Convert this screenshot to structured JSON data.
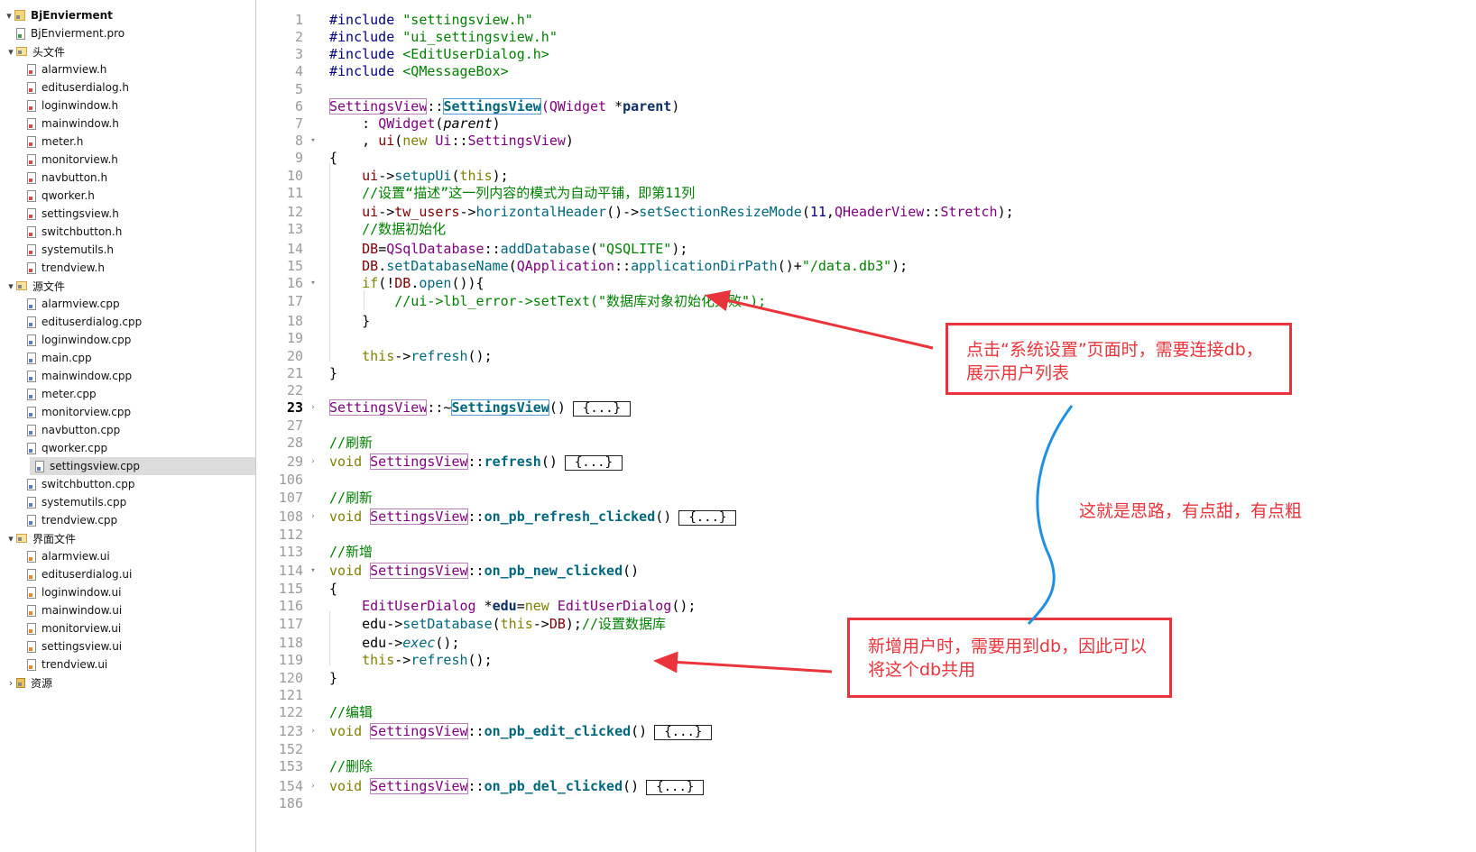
{
  "tree": {
    "items": [
      {
        "label": "BjEnvierment",
        "arrow": "▾",
        "indent": 0,
        "icon": "project-icon",
        "bold": true
      },
      {
        "label": "BjEnvierment.pro",
        "arrow": "",
        "indent": 1,
        "icon": "pro-file-icon"
      },
      {
        "label": "头文件",
        "arrow": "▾",
        "indent": 1,
        "icon": "headers-folder-icon"
      },
      {
        "label": "alarmview.h",
        "arrow": "",
        "indent": 2,
        "icon": "header-file-icon"
      },
      {
        "label": "edituserdialog.h",
        "arrow": "",
        "indent": 2,
        "icon": "header-file-icon"
      },
      {
        "label": "loginwindow.h",
        "arrow": "",
        "indent": 2,
        "icon": "header-file-icon"
      },
      {
        "label": "mainwindow.h",
        "arrow": "",
        "indent": 2,
        "icon": "header-file-icon"
      },
      {
        "label": "meter.h",
        "arrow": "",
        "indent": 2,
        "icon": "header-file-icon"
      },
      {
        "label": "monitorview.h",
        "arrow": "",
        "indent": 2,
        "icon": "header-file-icon"
      },
      {
        "label": "navbutton.h",
        "arrow": "",
        "indent": 2,
        "icon": "header-file-icon"
      },
      {
        "label": "qworker.h",
        "arrow": "",
        "indent": 2,
        "icon": "header-file-icon"
      },
      {
        "label": "settingsview.h",
        "arrow": "",
        "indent": 2,
        "icon": "header-file-icon"
      },
      {
        "label": "switchbutton.h",
        "arrow": "",
        "indent": 2,
        "icon": "header-file-icon"
      },
      {
        "label": "systemutils.h",
        "arrow": "",
        "indent": 2,
        "icon": "header-file-icon"
      },
      {
        "label": "trendview.h",
        "arrow": "",
        "indent": 2,
        "icon": "header-file-icon"
      },
      {
        "label": "源文件",
        "arrow": "▾",
        "indent": 1,
        "icon": "sources-folder-icon"
      },
      {
        "label": "alarmview.cpp",
        "arrow": "",
        "indent": 2,
        "icon": "cpp-file-icon"
      },
      {
        "label": "edituserdialog.cpp",
        "arrow": "",
        "indent": 2,
        "icon": "cpp-file-icon"
      },
      {
        "label": "loginwindow.cpp",
        "arrow": "",
        "indent": 2,
        "icon": "cpp-file-icon"
      },
      {
        "label": "main.cpp",
        "arrow": "",
        "indent": 2,
        "icon": "cpp-file-icon"
      },
      {
        "label": "mainwindow.cpp",
        "arrow": "",
        "indent": 2,
        "icon": "cpp-file-icon"
      },
      {
        "label": "meter.cpp",
        "arrow": "",
        "indent": 2,
        "icon": "cpp-file-icon"
      },
      {
        "label": "monitorview.cpp",
        "arrow": "",
        "indent": 2,
        "icon": "cpp-file-icon"
      },
      {
        "label": "navbutton.cpp",
        "arrow": "",
        "indent": 2,
        "icon": "cpp-file-icon"
      },
      {
        "label": "qworker.cpp",
        "arrow": "",
        "indent": 2,
        "icon": "cpp-file-icon"
      },
      {
        "label": "settingsview.cpp",
        "arrow": "",
        "indent": 2,
        "icon": "cpp-file-icon",
        "selected": true
      },
      {
        "label": "switchbutton.cpp",
        "arrow": "",
        "indent": 2,
        "icon": "cpp-file-icon"
      },
      {
        "label": "systemutils.cpp",
        "arrow": "",
        "indent": 2,
        "icon": "cpp-file-icon"
      },
      {
        "label": "trendview.cpp",
        "arrow": "",
        "indent": 2,
        "icon": "cpp-file-icon"
      },
      {
        "label": "界面文件",
        "arrow": "▾",
        "indent": 1,
        "icon": "forms-folder-icon"
      },
      {
        "label": "alarmview.ui",
        "arrow": "",
        "indent": 2,
        "icon": "ui-file-icon"
      },
      {
        "label": "edituserdialog.ui",
        "arrow": "",
        "indent": 2,
        "icon": "ui-file-icon"
      },
      {
        "label": "loginwindow.ui",
        "arrow": "",
        "indent": 2,
        "icon": "ui-file-icon"
      },
      {
        "label": "mainwindow.ui",
        "arrow": "",
        "indent": 2,
        "icon": "ui-file-icon"
      },
      {
        "label": "monitorview.ui",
        "arrow": "",
        "indent": 2,
        "icon": "ui-file-icon"
      },
      {
        "label": "settingsview.ui",
        "arrow": "",
        "indent": 2,
        "icon": "ui-file-icon"
      },
      {
        "label": "trendview.ui",
        "arrow": "",
        "indent": 2,
        "icon": "ui-file-icon"
      },
      {
        "label": "资源",
        "arrow": "›",
        "indent": 1,
        "icon": "resources-lock-icon"
      }
    ]
  },
  "editor": {
    "current_line": "23",
    "lines": [
      {
        "n": "1",
        "tokens": [
          [
            "pp",
            "#include "
          ],
          [
            "str",
            "\"settingsview.h\""
          ]
        ]
      },
      {
        "n": "2",
        "tokens": [
          [
            "pp",
            "#include "
          ],
          [
            "str",
            "\"ui_settingsview.h\""
          ]
        ]
      },
      {
        "n": "3",
        "tokens": [
          [
            "pp",
            "#include "
          ],
          [
            "str",
            "<EditUserDialog.h>"
          ]
        ]
      },
      {
        "n": "4",
        "tokens": [
          [
            "pp",
            "#include "
          ],
          [
            "str",
            "<QMessageBox>"
          ]
        ]
      },
      {
        "n": "5",
        "tokens": []
      },
      {
        "n": "6",
        "tokens": [
          [
            "cls boxed",
            "SettingsView"
          ],
          [
            "",
            "::"
          ],
          [
            "fnb boxed2",
            "SettingsView"
          ],
          [
            "cls",
            "(QWidget "
          ],
          [
            "",
            "*"
          ],
          [
            "bld",
            "parent"
          ],
          [
            "",
            ")"
          ]
        ]
      },
      {
        "n": "7",
        "tokens": [
          [
            "",
            "    : "
          ],
          [
            "cls",
            "QWidget"
          ],
          [
            "",
            "("
          ],
          [
            "ital",
            "parent"
          ],
          [
            "",
            ")"
          ]
        ]
      },
      {
        "n": "8",
        "fold": "▾",
        "tokens": [
          [
            "",
            "    , "
          ],
          [
            "mem",
            "ui"
          ],
          [
            "",
            "("
          ],
          [
            "kw",
            "new "
          ],
          [
            "cls",
            "Ui"
          ],
          [
            "",
            "::"
          ],
          [
            "cls",
            "SettingsView"
          ],
          [
            "",
            ")"
          ]
        ]
      },
      {
        "n": "9",
        "tokens": [
          [
            "",
            "{"
          ]
        ]
      },
      {
        "n": "10",
        "tokens": [
          [
            "",
            "    "
          ],
          [
            "mem",
            "ui"
          ],
          [
            "",
            "->"
          ],
          [
            "fn",
            "setupUi"
          ],
          [
            "",
            "("
          ],
          [
            "kw",
            "this"
          ],
          [
            "",
            ");"
          ]
        ]
      },
      {
        "n": "11",
        "tokens": [
          [
            "",
            "    "
          ],
          [
            "cm",
            "//设置“描述”这一列内容的模式为自动平铺，即第11列"
          ]
        ]
      },
      {
        "n": "12",
        "tokens": [
          [
            "",
            "    "
          ],
          [
            "mem",
            "ui"
          ],
          [
            "",
            "->"
          ],
          [
            "mem",
            "tw_users"
          ],
          [
            "",
            "->"
          ],
          [
            "fn",
            "horizontalHeader"
          ],
          [
            "",
            "()->"
          ],
          [
            "fn",
            "setSectionResizeMode"
          ],
          [
            "",
            "("
          ],
          [
            "num",
            "11"
          ],
          [
            "",
            ","
          ],
          [
            "cls",
            "QHeaderView"
          ],
          [
            "",
            "::"
          ],
          [
            "cls",
            "Stretch"
          ],
          [
            "",
            ");"
          ]
        ]
      },
      {
        "n": "13",
        "tokens": [
          [
            "",
            "    "
          ],
          [
            "cm",
            "//数据初始化"
          ]
        ]
      },
      {
        "n": "14",
        "tokens": [
          [
            "",
            "    "
          ],
          [
            "mem",
            "DB"
          ],
          [
            "",
            "="
          ],
          [
            "cls",
            "QSqlDatabase"
          ],
          [
            "",
            "::"
          ],
          [
            "fn",
            "addDatabase"
          ],
          [
            "",
            "("
          ],
          [
            "str",
            "\"QSQLITE\""
          ],
          [
            "",
            ");"
          ]
        ]
      },
      {
        "n": "15",
        "tokens": [
          [
            "",
            "    "
          ],
          [
            "mem",
            "DB"
          ],
          [
            "",
            "."
          ],
          [
            "fn",
            "setDatabaseName"
          ],
          [
            "",
            "("
          ],
          [
            "cls",
            "QApplication"
          ],
          [
            "",
            "::"
          ],
          [
            "fn",
            "applicationDirPath"
          ],
          [
            "",
            "()+"
          ],
          [
            "str",
            "\"/data.db3\""
          ],
          [
            "",
            ");"
          ]
        ]
      },
      {
        "n": "16",
        "fold": "▾",
        "tokens": [
          [
            "",
            "    "
          ],
          [
            "kw",
            "if"
          ],
          [
            "",
            "(!"
          ],
          [
            "mem",
            "DB"
          ],
          [
            "",
            "."
          ],
          [
            "fn",
            "open"
          ],
          [
            "",
            "()){"
          ]
        ]
      },
      {
        "n": "17",
        "guide": true,
        "tokens": [
          [
            "",
            "        "
          ],
          [
            "cm",
            "//ui->lbl_error->setText(\"数据库对象初始化失败\");"
          ]
        ]
      },
      {
        "n": "18",
        "tokens": [
          [
            "",
            "    }"
          ]
        ]
      },
      {
        "n": "19",
        "tokens": []
      },
      {
        "n": "20",
        "tokens": [
          [
            "",
            "    "
          ],
          [
            "kw",
            "this"
          ],
          [
            "",
            "->"
          ],
          [
            "fn",
            "refresh"
          ],
          [
            "",
            "();"
          ]
        ]
      },
      {
        "n": "21",
        "tokens": [
          [
            "",
            "}"
          ]
        ]
      },
      {
        "n": "22",
        "tokens": []
      },
      {
        "n": "23",
        "fold": "›",
        "tokens": [
          [
            "cls boxed",
            "SettingsView"
          ],
          [
            "",
            "::~"
          ],
          [
            "fnb boxed2",
            "SettingsView"
          ],
          [
            "",
            "()"
          ]
        ],
        "collapsed": "{...}"
      },
      {
        "n": "27",
        "tokens": []
      },
      {
        "n": "28",
        "tokens": [
          [
            "cm",
            "//刷新"
          ]
        ]
      },
      {
        "n": "29",
        "fold": "›",
        "tokens": [
          [
            "kw",
            "void "
          ],
          [
            "cls boxed",
            "SettingsView"
          ],
          [
            "",
            "::"
          ],
          [
            "fnb",
            "refresh"
          ],
          [
            "",
            "()"
          ]
        ],
        "collapsed": "{...}"
      },
      {
        "n": "106",
        "tokens": []
      },
      {
        "n": "107",
        "tokens": [
          [
            "cm",
            "//刷新"
          ]
        ]
      },
      {
        "n": "108",
        "fold": "›",
        "tokens": [
          [
            "kw",
            "void "
          ],
          [
            "cls boxed",
            "SettingsView"
          ],
          [
            "",
            "::"
          ],
          [
            "fnb",
            "on_pb_refresh_clicked"
          ],
          [
            "",
            "()"
          ]
        ],
        "collapsed": "{...}"
      },
      {
        "n": "112",
        "tokens": []
      },
      {
        "n": "113",
        "tokens": [
          [
            "cm",
            "//新增"
          ]
        ]
      },
      {
        "n": "114",
        "fold": "▾",
        "tokens": [
          [
            "kw",
            "void "
          ],
          [
            "cls boxed",
            "SettingsView"
          ],
          [
            "",
            "::"
          ],
          [
            "fnb",
            "on_pb_new_clicked"
          ],
          [
            "",
            "()"
          ]
        ]
      },
      {
        "n": "115",
        "tokens": [
          [
            "",
            "{"
          ]
        ]
      },
      {
        "n": "116",
        "tokens": [
          [
            "",
            "    "
          ],
          [
            "cls",
            "EditUserDialog "
          ],
          [
            "",
            "*"
          ],
          [
            "bld",
            "edu"
          ],
          [
            "",
            "="
          ],
          [
            "kw",
            "new "
          ],
          [
            "cls",
            "EditUserDialog"
          ],
          [
            "",
            "();"
          ]
        ]
      },
      {
        "n": "117",
        "tokens": [
          [
            "",
            "    edu->"
          ],
          [
            "fn",
            "setDatabase"
          ],
          [
            "",
            "("
          ],
          [
            "kw",
            "this"
          ],
          [
            "",
            "->"
          ],
          [
            "mem",
            "DB"
          ],
          [
            "",
            ");"
          ],
          [
            "cm",
            "//设置数据库"
          ]
        ]
      },
      {
        "n": "118",
        "tokens": [
          [
            "",
            "    edu->"
          ],
          [
            "fn ital",
            "exec"
          ],
          [
            "",
            "();"
          ]
        ]
      },
      {
        "n": "119",
        "tokens": [
          [
            "",
            "    "
          ],
          [
            "kw",
            "this"
          ],
          [
            "",
            "->"
          ],
          [
            "fn",
            "refresh"
          ],
          [
            "",
            "();"
          ]
        ]
      },
      {
        "n": "120",
        "tokens": [
          [
            "",
            "}"
          ]
        ]
      },
      {
        "n": "121",
        "tokens": []
      },
      {
        "n": "122",
        "tokens": [
          [
            "cm",
            "//编辑"
          ]
        ]
      },
      {
        "n": "123",
        "fold": "›",
        "tokens": [
          [
            "kw",
            "void "
          ],
          [
            "cls boxed",
            "SettingsView"
          ],
          [
            "",
            "::"
          ],
          [
            "fnb",
            "on_pb_edit_clicked"
          ],
          [
            "",
            "()"
          ]
        ],
        "collapsed": "{...}"
      },
      {
        "n": "152",
        "tokens": []
      },
      {
        "n": "153",
        "tokens": [
          [
            "cm",
            "//删除"
          ]
        ]
      },
      {
        "n": "154",
        "fold": "›",
        "tokens": [
          [
            "kw",
            "void "
          ],
          [
            "cls boxed",
            "SettingsView"
          ],
          [
            "",
            "::"
          ],
          [
            "fnb",
            "on_pb_del_clicked"
          ],
          [
            "",
            "()"
          ]
        ],
        "collapsed": "{...}"
      },
      {
        "n": "186",
        "tokens": []
      }
    ]
  },
  "annotations": {
    "callout_top": "点击“系统设置”页面时，需要连接db，展示用户列表",
    "callout_bottom": "新增用户时，需要用到db，因此可以将这个db共用",
    "middle_note": "这就是思路，有点甜，有点粗",
    "colors": {
      "red": "#e8343a",
      "blue": "#1f8fe6"
    }
  }
}
